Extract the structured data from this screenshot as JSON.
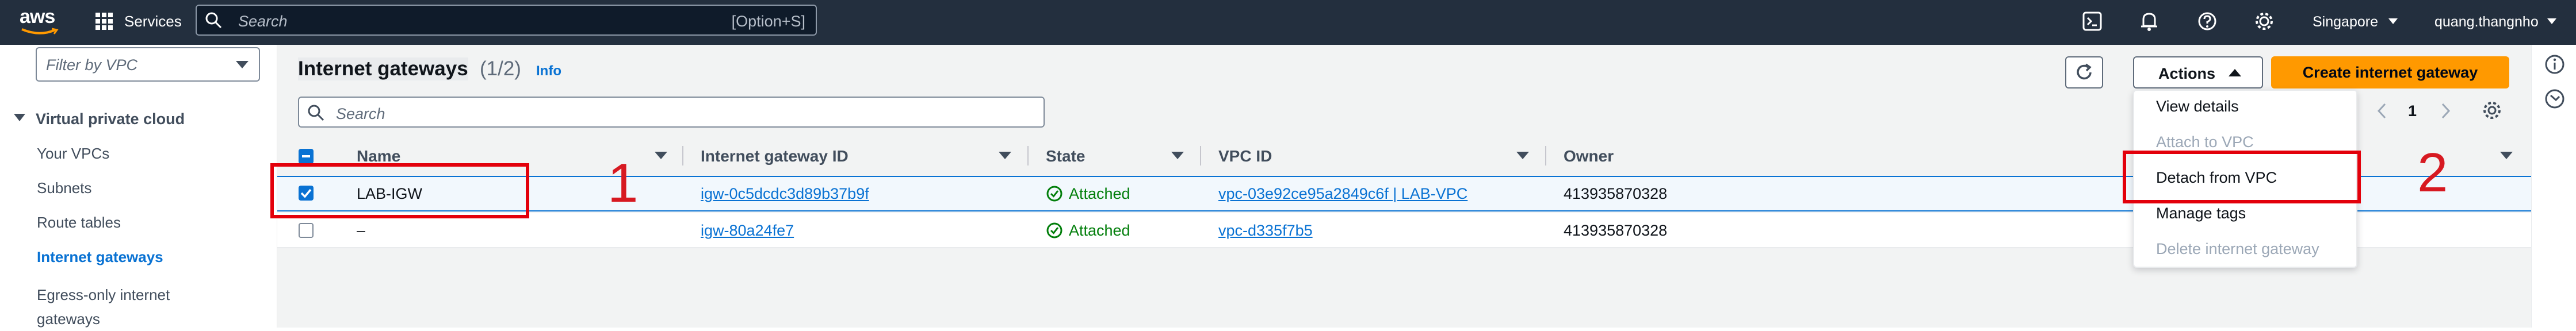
{
  "topnav": {
    "logo": "aws",
    "services_label": "Services",
    "search_placeholder": "Search",
    "search_shortcut": "[Option+S]",
    "region": "Singapore",
    "account": "quang.thangnho"
  },
  "sidebar": {
    "filter_placeholder": "Filter by VPC",
    "section_title": "Virtual private cloud",
    "items": [
      {
        "label": "Your VPCs"
      },
      {
        "label": "Subnets"
      },
      {
        "label": "Route tables"
      },
      {
        "label": "Internet gateways",
        "active": true
      },
      {
        "label": "Egress-only internet gateways"
      }
    ]
  },
  "main": {
    "title": "Internet gateways",
    "count": "(1/2)",
    "info": "Info",
    "search_placeholder": "Search",
    "actions_label": "Actions",
    "create_label": "Create internet gateway",
    "page_number": "1",
    "columns": [
      "Name",
      "Internet gateway ID",
      "State",
      "VPC ID",
      "Owner"
    ],
    "rows": [
      {
        "selected": true,
        "name": "LAB-IGW",
        "id": "igw-0c5dcdc3d89b37b9f",
        "state": "Attached",
        "vpc": "vpc-03e92ce95a2849c6f | LAB-VPC",
        "owner": "413935870328"
      },
      {
        "selected": false,
        "name": "–",
        "id": "igw-80a24fe7",
        "state": "Attached",
        "vpc": "vpc-d335f7b5",
        "owner": "413935870328"
      }
    ]
  },
  "actions_menu": {
    "items": [
      {
        "label": "View details",
        "enabled": true
      },
      {
        "label": "Attach to VPC",
        "enabled": false
      },
      {
        "label": "Detach from VPC",
        "enabled": true
      },
      {
        "label": "Manage tags",
        "enabled": true
      },
      {
        "label": "Delete internet gateway",
        "enabled": false
      }
    ]
  },
  "annotations": {
    "step1": "1",
    "step2": "2",
    "highlight_color": "#e3000b"
  },
  "colors": {
    "nav_bg": "#232f3e",
    "primary_button": "#ff9900",
    "link": "#0972d3",
    "success": "#037f0c",
    "selected_row_bg": "#f2f8fd",
    "selected_row_border": "#0972d3"
  }
}
